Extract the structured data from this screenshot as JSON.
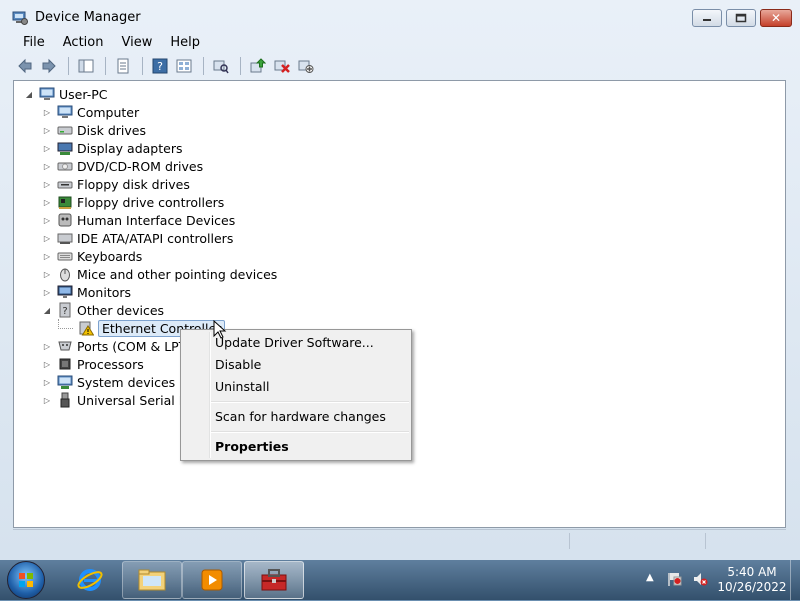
{
  "window": {
    "title": "Device Manager",
    "close_glyph": "✕",
    "min_icon": "minimize-icon",
    "max_icon": "maximize-icon"
  },
  "menu": [
    "File",
    "Action",
    "View",
    "Help"
  ],
  "toolbar": {
    "icons": [
      "back-arrow-icon",
      "forward-arrow-icon",
      "show-hide-console-tree-icon",
      "properties-sheet-icon",
      "help-icon",
      "view-icon",
      "scan-hardware-icon",
      "update-driver-icon",
      "uninstall-device-icon",
      "disable-device-icon"
    ]
  },
  "tree": {
    "root": "User-PC",
    "categories": [
      {
        "label": "Computer",
        "icon": "computer-icon"
      },
      {
        "label": "Disk drives",
        "icon": "disk-drive-icon"
      },
      {
        "label": "Display adapters",
        "icon": "display-adapter-icon"
      },
      {
        "label": "DVD/CD-ROM drives",
        "icon": "dvd-drive-icon"
      },
      {
        "label": "Floppy disk drives",
        "icon": "floppy-disk-icon"
      },
      {
        "label": "Floppy drive controllers",
        "icon": "floppy-controller-icon"
      },
      {
        "label": "Human Interface Devices",
        "icon": "hid-icon"
      },
      {
        "label": "IDE ATA/ATAPI controllers",
        "icon": "ide-controller-icon"
      },
      {
        "label": "Keyboards",
        "icon": "keyboard-icon"
      },
      {
        "label": "Mice and other pointing devices",
        "icon": "mouse-icon"
      },
      {
        "label": "Monitors",
        "icon": "monitor-icon"
      },
      {
        "label": "Other devices",
        "icon": "unknown-device-icon",
        "expanded": true
      },
      {
        "label": "Ethernet Controller",
        "icon": "warning-device-icon",
        "child": true,
        "selected": true
      },
      {
        "label": "Ports (COM & LPT)",
        "icon": "port-icon"
      },
      {
        "label": "Processors",
        "icon": "processor-icon"
      },
      {
        "label": "System devices",
        "icon": "system-device-icon"
      },
      {
        "label": "Universal Serial Bus",
        "icon": "usb-icon"
      }
    ]
  },
  "context_menu": {
    "update_driver": "Update Driver Software...",
    "disable": "Disable",
    "uninstall": "Uninstall",
    "scan": "Scan for hardware changes",
    "properties": "Properties"
  },
  "taskbar": {
    "items": [
      "internet-explorer-icon",
      "windows-explorer-icon",
      "media-player-icon",
      "device-manager-toolbox-icon"
    ],
    "tray_icons": [
      "show-hidden-icons-arrow",
      "action-center-flag-icon",
      "network-icon",
      "volume-muted-icon"
    ],
    "time": "5:40 AM",
    "date": "10/26/2022"
  },
  "colors": {
    "accent": "#3d6ea5",
    "warning": "#f2c100",
    "close_red": "#c4402a"
  }
}
